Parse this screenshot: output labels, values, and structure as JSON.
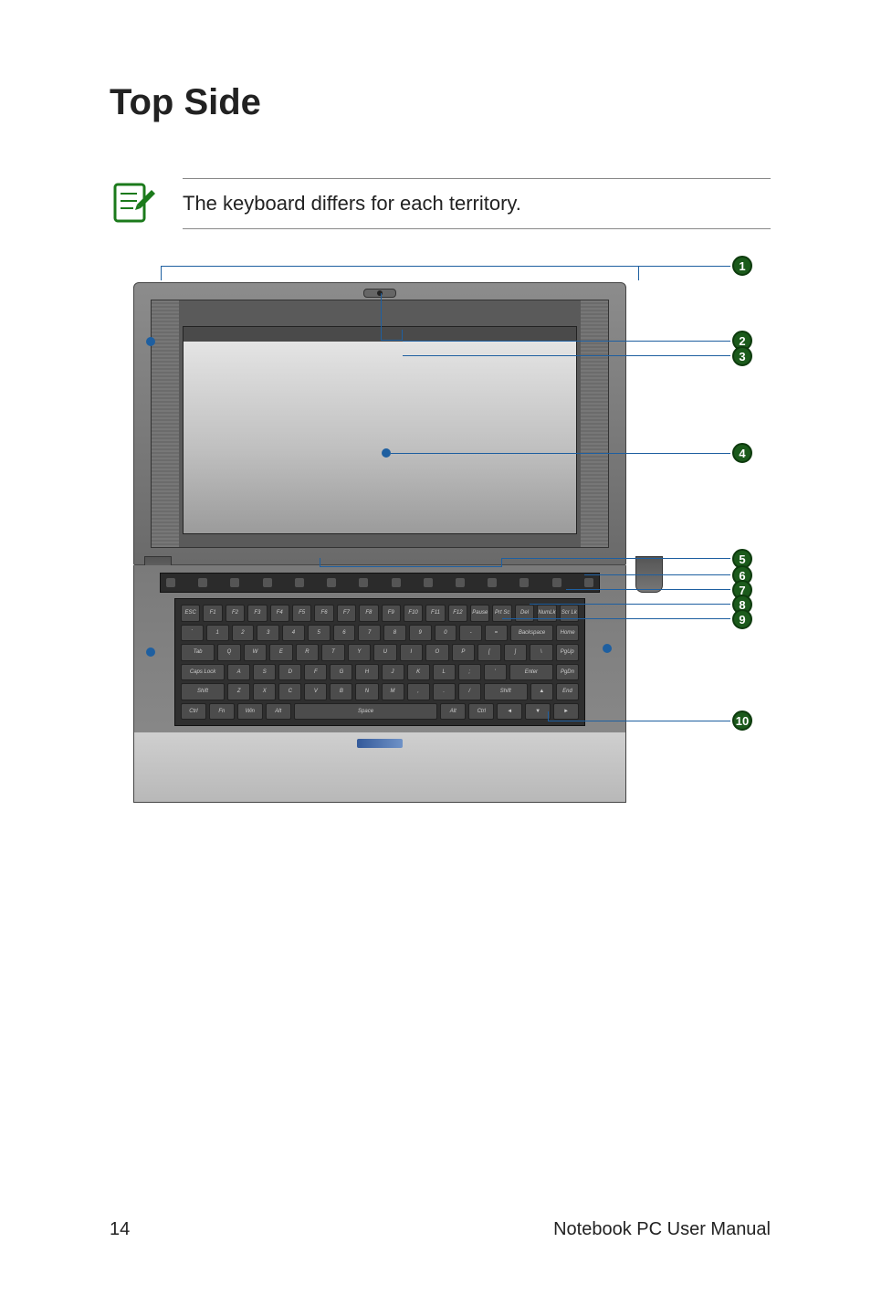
{
  "page": {
    "title": "Top Side",
    "note": "The keyboard differs for each territory.",
    "footer_page": "14",
    "footer_text": "Notebook PC User Manual"
  },
  "callouts": [
    "1",
    "2",
    "3",
    "4",
    "5",
    "6",
    "7",
    "8",
    "9",
    "10"
  ],
  "keyboard": {
    "row1": [
      "ESC",
      "F1",
      "F2",
      "F3",
      "F4",
      "F5",
      "F6",
      "F7",
      "F8",
      "F9",
      "F10",
      "F11",
      "F12",
      "Pause",
      "Prt Sc",
      "Del",
      "NumLk",
      "Scr Lk"
    ],
    "row2": [
      "`",
      "1",
      "2",
      "3",
      "4",
      "5",
      "6",
      "7",
      "8",
      "9",
      "0",
      "-",
      "=",
      "Backspace",
      "Home"
    ],
    "row3": [
      "Tab",
      "Q",
      "W",
      "E",
      "R",
      "T",
      "Y",
      "U",
      "I",
      "O",
      "P",
      "[",
      "]",
      "\\",
      "PgUp"
    ],
    "row4": [
      "Caps Lock",
      "A",
      "S",
      "D",
      "F",
      "G",
      "H",
      "J",
      "K",
      "L",
      ";",
      "'",
      "Enter",
      "PgDn"
    ],
    "row5": [
      "Shift",
      "Z",
      "X",
      "C",
      "V",
      "B",
      "N",
      "M",
      ",",
      ".",
      "/",
      "Shift",
      "▲",
      "End"
    ],
    "row6": [
      "Ctrl",
      "Fn",
      "Win",
      "Alt",
      "Space",
      "Alt",
      "Ctrl",
      "◄",
      "▼",
      "►"
    ]
  }
}
